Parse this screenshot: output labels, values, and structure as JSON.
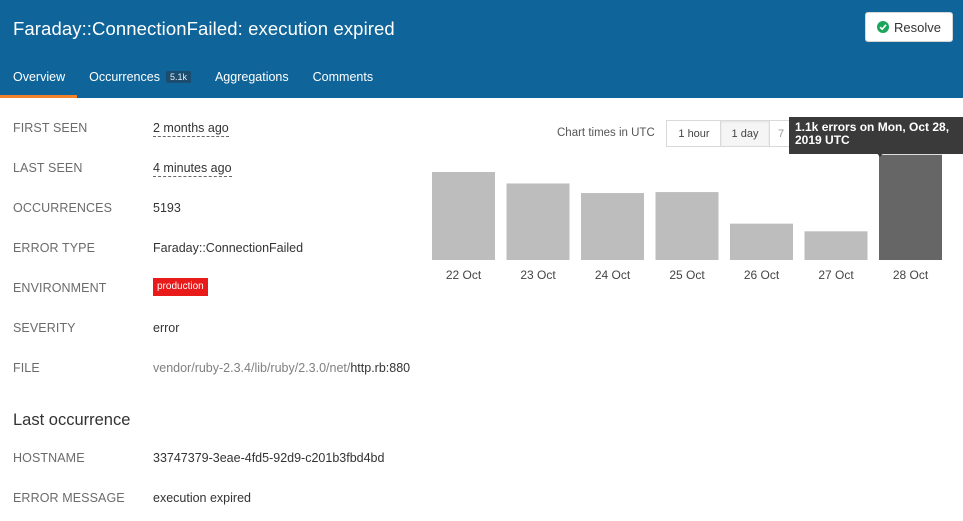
{
  "header": {
    "title": "Faraday::ConnectionFailed: execution expired",
    "resolve_label": "Resolve"
  },
  "tabs": [
    {
      "label": "Overview",
      "active": true
    },
    {
      "label": "Occurrences",
      "count": "5.1k"
    },
    {
      "label": "Aggregations"
    },
    {
      "label": "Comments"
    }
  ],
  "details": {
    "first_seen": {
      "label": "FIRST SEEN",
      "value": "2 months ago"
    },
    "last_seen": {
      "label": "LAST SEEN",
      "value": "4 minutes ago"
    },
    "occurrences": {
      "label": "OCCURRENCES",
      "value": "5193"
    },
    "error_type": {
      "label": "ERROR TYPE",
      "value": "Faraday::ConnectionFailed"
    },
    "environment": {
      "label": "ENVIRONMENT",
      "value": "production"
    },
    "severity": {
      "label": "SEVERITY",
      "value": "error"
    },
    "file": {
      "label": "FILE",
      "prefix": "vendor/ruby-2.3.4/lib/ruby/2.3.0/net/",
      "name": "http.rb",
      "line": ":880"
    }
  },
  "last_occurrence": {
    "title": "Last occurrence",
    "hostname": {
      "label": "HOSTNAME",
      "value": "33747379-3eae-4fd5-92d9-c201b3fbd4bd"
    },
    "error_message": {
      "label": "ERROR MESSAGE",
      "value": "execution expired"
    }
  },
  "chart_controls": {
    "times_label": "Chart times in UTC",
    "ranges": [
      {
        "label": "1 hour"
      },
      {
        "label": "1 day",
        "active": true
      },
      {
        "label": "7"
      }
    ]
  },
  "tooltip": {
    "line1": "1.1k errors on Mon, Oct 28,",
    "line2": "2019 UTC"
  },
  "colors": {
    "header_bg": "#0f6499",
    "tab_underline": "#f4822a",
    "bar": "#bdbdbd",
    "bar_highlight": "#666666",
    "badge": "#e81a1a",
    "resolve_check": "#1aa55b"
  },
  "chart_data": {
    "type": "bar",
    "categories": [
      "22 Oct",
      "23 Oct",
      "24 Oct",
      "25 Oct",
      "26 Oct",
      "27 Oct",
      "28 Oct"
    ],
    "values": [
      920,
      800,
      700,
      710,
      380,
      300,
      1100
    ],
    "highlighted_index": 6,
    "ylim": [
      0,
      1150
    ],
    "grid": false
  }
}
